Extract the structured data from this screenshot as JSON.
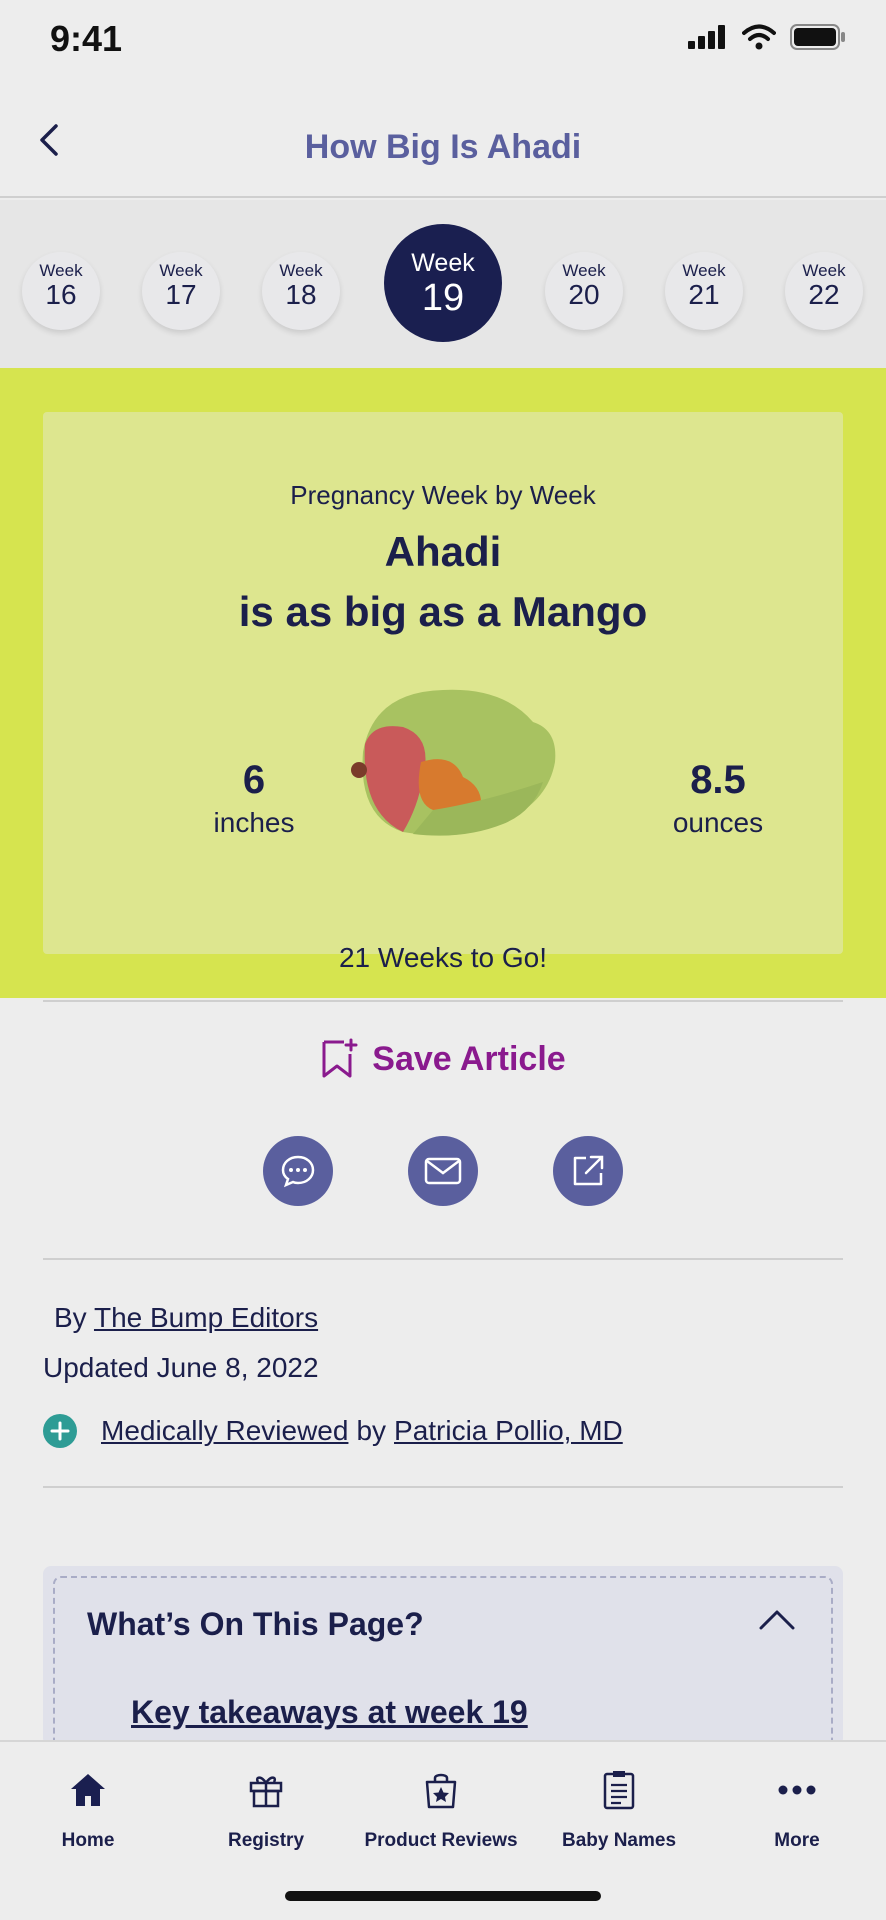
{
  "status_bar": {
    "time": "9:41"
  },
  "header": {
    "title": "How Big Is Ahadi"
  },
  "weeks": [
    {
      "label": "Week",
      "number": "16"
    },
    {
      "label": "Week",
      "number": "17"
    },
    {
      "label": "Week",
      "number": "18"
    },
    {
      "label": "Week",
      "number": "19",
      "active": true
    },
    {
      "label": "Week",
      "number": "20"
    },
    {
      "label": "Week",
      "number": "21"
    },
    {
      "label": "Week",
      "number": "22"
    }
  ],
  "hero": {
    "kicker": "Pregnancy Week by Week",
    "name": "Ahadi",
    "size_line": "is as big as a Mango",
    "length_value": "6",
    "length_unit": "inches",
    "weight_value": "8.5",
    "weight_unit": "ounces",
    "weeks_to_go": "21 Weeks to Go!",
    "colors": {
      "background": "#d6e44f",
      "card": "#dde68f"
    }
  },
  "actions": {
    "save_label": "Save Article",
    "share_icons": [
      "chat-bubble-icon",
      "mail-icon",
      "external-share-icon"
    ]
  },
  "byline": {
    "by": "By",
    "author": "The Bump Editors",
    "updated": "Updated June 8, 2022",
    "reviewed_link": "Medically Reviewed",
    "reviewed_by": "by",
    "reviewer": "Patricia Pollio, MD"
  },
  "toc": {
    "title": "What’s On This Page?",
    "first_link": "Key takeaways at week 19"
  },
  "tabs": [
    {
      "label": "Home",
      "icon": "home-icon"
    },
    {
      "label": "Registry",
      "icon": "gift-icon"
    },
    {
      "label": "Product Reviews",
      "icon": "shopping-bag-star-icon"
    },
    {
      "label": "Baby Names",
      "icon": "clipboard-list-icon"
    },
    {
      "label": "More",
      "icon": "more-dots-icon"
    }
  ],
  "colors": {
    "accent": "#5a5f9e",
    "brand_navy": "#1a1f50",
    "save_purple": "#8a1a8e",
    "reviewed_teal": "#2e9c95"
  }
}
